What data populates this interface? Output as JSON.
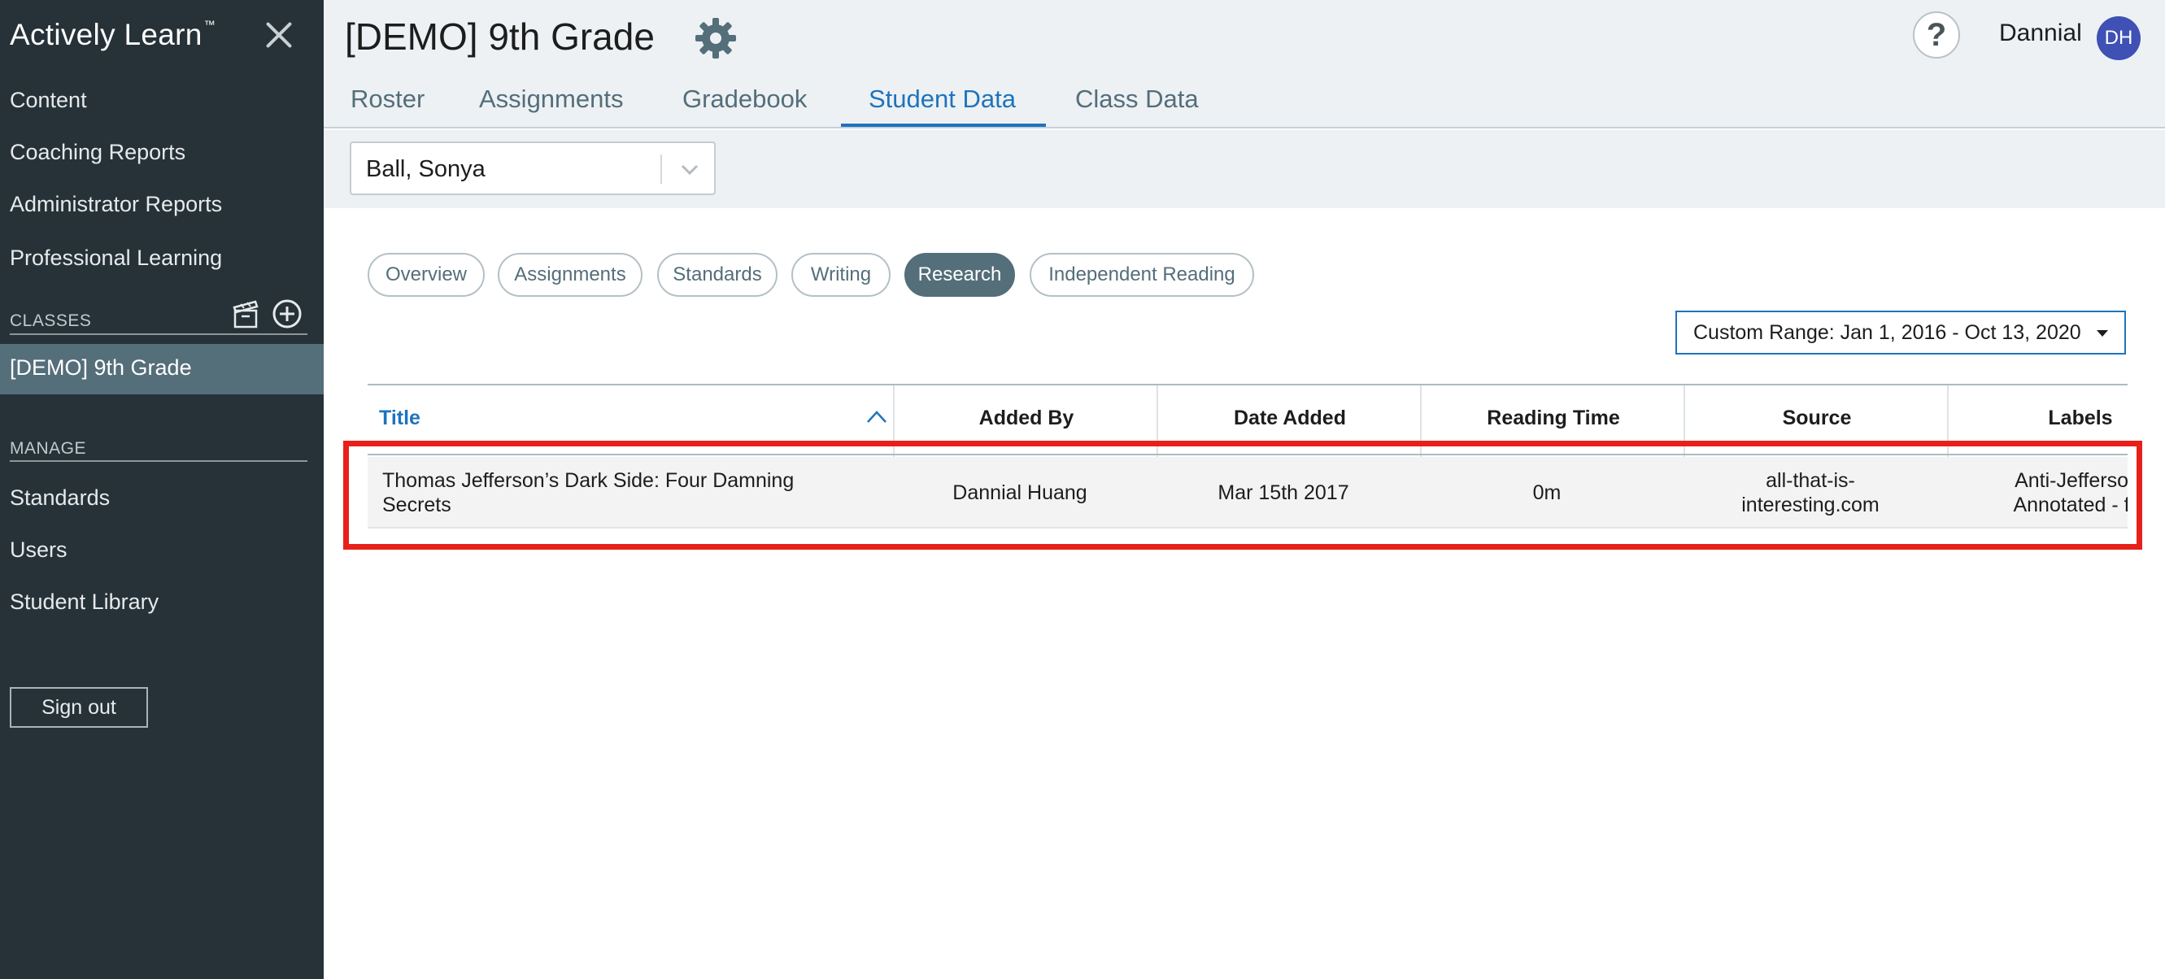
{
  "sidebar": {
    "brand": "Actively Learn",
    "brand_mark": "™",
    "nav": [
      "Content",
      "Coaching Reports",
      "Administrator Reports",
      "Professional Learning"
    ],
    "classes_label": "CLASSES",
    "active_class": "[DEMO] 9th Grade",
    "manage_label": "MANAGE",
    "manage_items": [
      "Standards",
      "Users",
      "Student Library"
    ],
    "sign_out": "Sign out"
  },
  "header": {
    "title": "[DEMO] 9th Grade",
    "user_name": "Dannial",
    "user_initials": "DH",
    "help": "?",
    "tabs": [
      "Roster",
      "Assignments",
      "Gradebook",
      "Student Data",
      "Class Data"
    ],
    "active_tab": "Student Data"
  },
  "student_select": {
    "value": "Ball, Sonya"
  },
  "subtabs": [
    "Overview",
    "Assignments",
    "Standards",
    "Writing",
    "Research",
    "Independent Reading"
  ],
  "active_subtab": "Research",
  "date_range": "Custom Range: Jan 1, 2016 - Oct 13, 2020",
  "table": {
    "columns": [
      "Title",
      "Added By",
      "Date Added",
      "Reading Time",
      "Source",
      "Labels"
    ],
    "rows": [
      {
        "title": "Thomas Jefferson’s Dark Side: Four Damning Secrets",
        "added_by": "Dannial Huang",
        "date_added": "Mar 15th 2017",
        "reading_time": "0m",
        "source": "all-that-is-interesting.com",
        "labels": "Anti-Jefferson Annotated - fe"
      }
    ]
  },
  "colors": {
    "sidebar": "#263238",
    "accent": "#1e73be",
    "active_chip": "#546e7a",
    "highlight": "#e8201c"
  }
}
